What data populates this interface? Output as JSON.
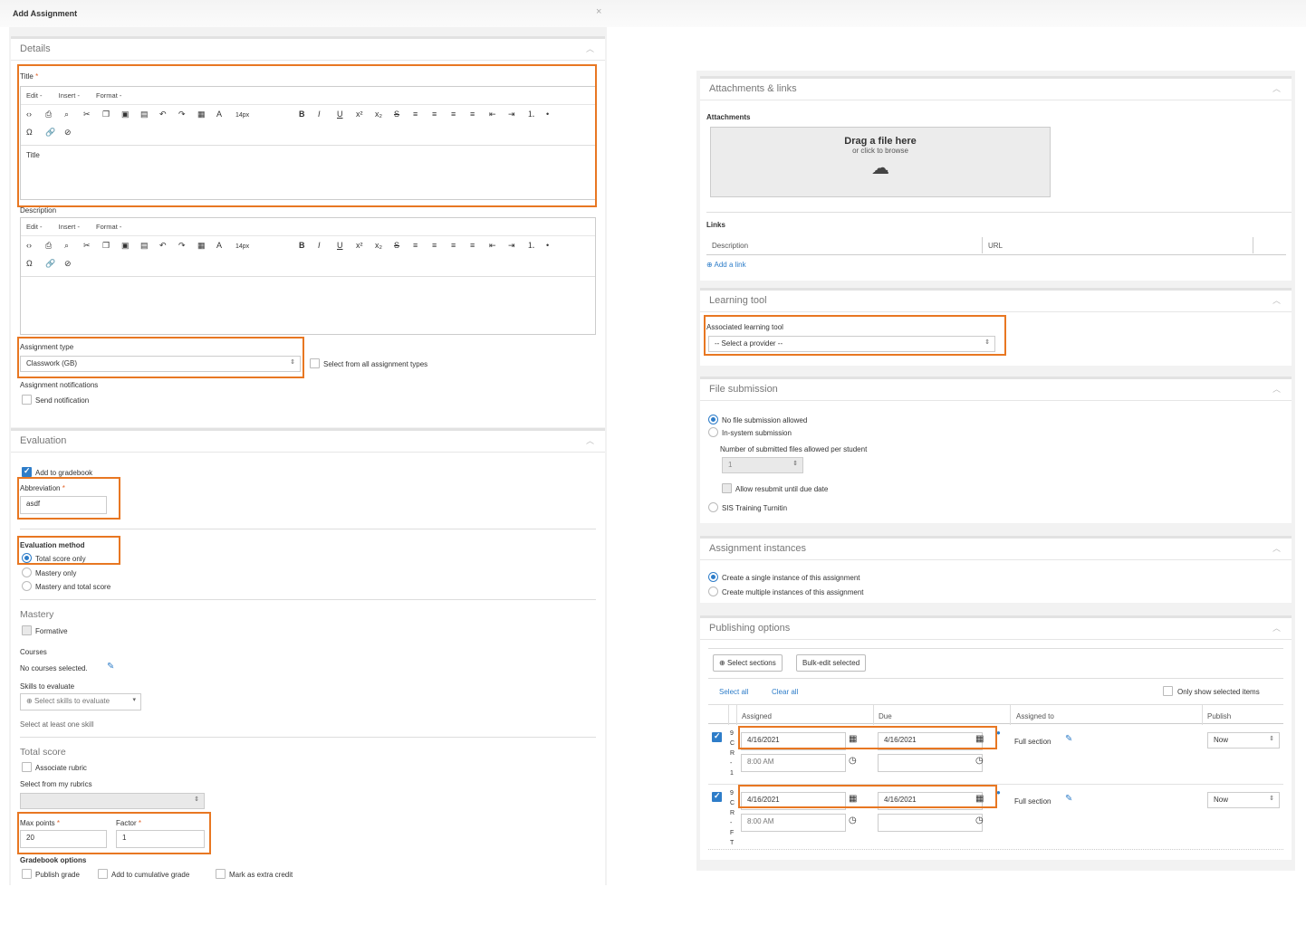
{
  "dialog": {
    "title": "Add Assignment",
    "close": "×"
  },
  "details": {
    "header": "Details",
    "title_label": "Title",
    "required_mark": "*",
    "menu": [
      "Edit -",
      "Insert -",
      "Format -"
    ],
    "font_size": "14px",
    "title_placeholder": "Title",
    "description_label": "Description",
    "assignment_type_label": "Assignment type",
    "assignment_type_value": "Classwork (GB)",
    "select_all_types": "Select from all assignment types",
    "notifications_label": "Assignment notifications",
    "send_notification": "Send notification"
  },
  "evaluation": {
    "header": "Evaluation",
    "add_to_gradebook": "Add to gradebook",
    "abbreviation_label": "Abbreviation",
    "abbreviation_value": "asdf",
    "method_label": "Evaluation method",
    "methods": [
      "Total score only",
      "Mastery only",
      "Mastery and total score"
    ],
    "mastery_title": "Mastery",
    "formative": "Formative",
    "courses_label": "Courses",
    "courses_value": "No courses selected.",
    "skills_label": "Skills to evaluate",
    "skills_select": "Select skills to evaluate",
    "skills_hint": "Select at least one skill",
    "total_score_title": "Total score",
    "associate_rubric": "Associate rubric",
    "rubrics_label": "Select from my rubrics",
    "max_points_label": "Max points",
    "max_points_value": "20",
    "factor_label": "Factor",
    "factor_value": "1",
    "gradebook_options": "Gradebook options",
    "publish_grade": "Publish grade",
    "add_cumulative": "Add to cumulative grade",
    "extra_credit": "Mark as extra credit"
  },
  "attachments": {
    "header": "Attachments & links",
    "attachments_label": "Attachments",
    "drop_title": "Drag a file here",
    "drop_sub": "or click to browse",
    "links_label": "Links",
    "col_description": "Description",
    "col_url": "URL",
    "add_link": "Add a link"
  },
  "learning_tool": {
    "header": "Learning tool",
    "label": "Associated learning tool",
    "value": "-- Select a provider --"
  },
  "file_submission": {
    "header": "File submission",
    "opt_none": "No file submission allowed",
    "opt_system": "In-system submission",
    "num_files_label": "Number of submitted files allowed per student",
    "num_files_value": "1",
    "allow_resubmit": "Allow resubmit until due date",
    "opt_turnitin": "SIS Training Turnitin"
  },
  "instances": {
    "header": "Assignment instances",
    "opt_single": "Create a single instance of this assignment",
    "opt_multiple": "Create multiple instances of this assignment"
  },
  "publishing": {
    "header": "Publishing options",
    "select_sections": "Select sections",
    "bulk_edit": "Bulk-edit selected",
    "select_all": "Select all",
    "clear_all": "Clear all",
    "only_selected": "Only show selected items",
    "col_assigned": "Assigned",
    "col_due": "Due",
    "col_assigned_to": "Assigned to",
    "col_publish": "Publish",
    "rows": [
      {
        "section": "9\nC\nR\n-\n1",
        "assigned_date": "4/16/2021",
        "assigned_time": "8:00 AM",
        "due_date": "4/16/2021",
        "due_time": "",
        "assigned_to": "Full section",
        "publish": "Now"
      },
      {
        "section": "9\nC\nR\n-\nF\nT",
        "assigned_date": "4/16/2021",
        "assigned_time": "8:00 AM",
        "due_date": "4/16/2021",
        "due_time": "",
        "assigned_to": "Full section",
        "publish": "Now"
      }
    ]
  },
  "colors": {
    "highlight": "#e87722",
    "accent": "#2e7dc9"
  }
}
